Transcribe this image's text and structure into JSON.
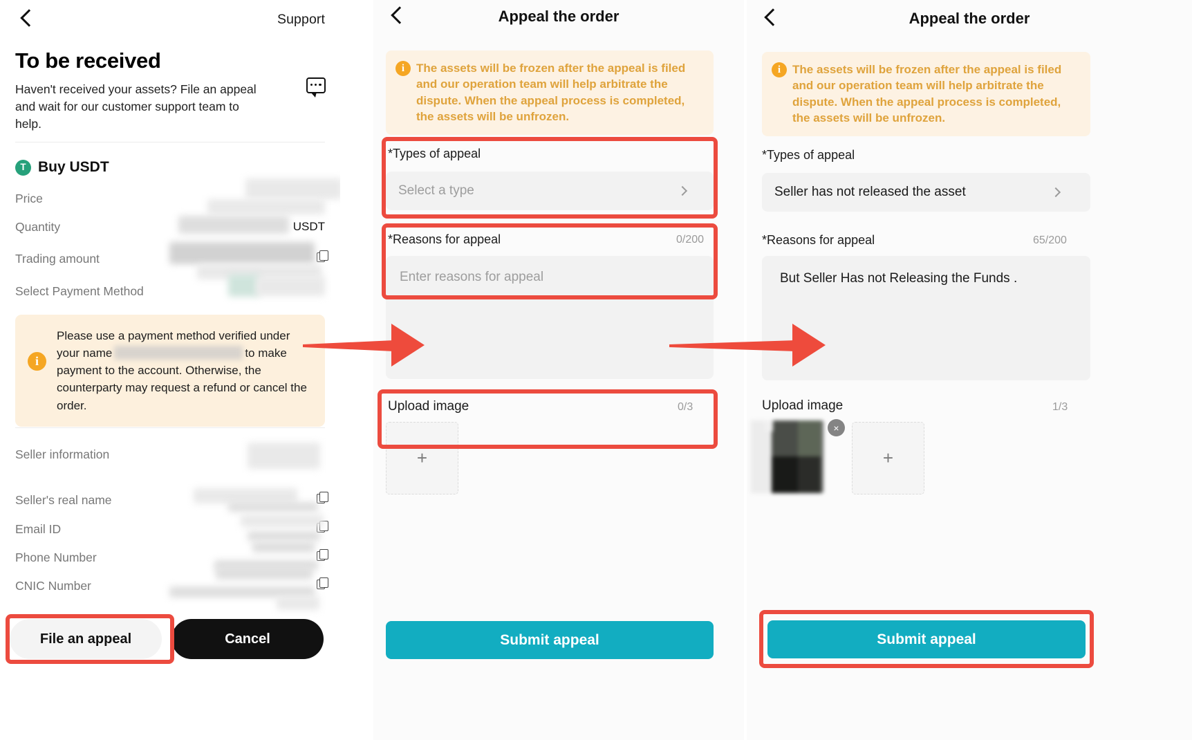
{
  "panel1": {
    "nav": {
      "back_icon": "back-chevron-icon",
      "support_label": "Support"
    },
    "title": "To be received",
    "subtitle": "Haven't received your assets? File an appeal and wait for our customer support team to help.",
    "chat_icon": "chat-bubble-icon",
    "coin": {
      "badge_symbol": "T",
      "label": "Buy USDT",
      "badge_color": "#26A17B"
    },
    "rows": [
      {
        "label": "Price",
        "value": "",
        "suffix": "",
        "copy": false
      },
      {
        "label": "Quantity",
        "value": "",
        "suffix": "USDT",
        "copy": false
      },
      {
        "label": "Trading amount",
        "value": "",
        "suffix": "",
        "copy": true
      },
      {
        "label": "Select Payment Method",
        "value": "",
        "suffix": "",
        "copy": false
      }
    ],
    "warning": {
      "icon": "info-icon",
      "text_before": "Please use a payment method verified under your name",
      "text_after": "to make payment to the account. Otherwise, the counterparty may request a refund or cancel the order.",
      "bg": "#FDF0DD"
    },
    "seller_section": [
      {
        "label": "Seller information",
        "copy": false
      },
      {
        "label": "Seller's real name",
        "copy": true
      },
      {
        "label": "Email ID",
        "copy": true
      },
      {
        "label": "Phone Number",
        "copy": true
      },
      {
        "label": "CNIC Number",
        "copy": true
      }
    ],
    "buttons": {
      "file_appeal": "File an appeal",
      "cancel": "Cancel"
    }
  },
  "panel2": {
    "nav": {
      "back_icon": "back-chevron-icon",
      "title": "Appeal the order"
    },
    "notice": {
      "icon": "info-icon",
      "text": "The assets will be frozen after the appeal is filed and our operation team will help arbitrate the dispute. When the appeal process is completed, the assets will be unfrozen.",
      "color": "#DFA33C",
      "bg": "#FDF2E3"
    },
    "types_of_appeal": {
      "label": "*Types of appeal",
      "value": "",
      "placeholder": "Select a type",
      "chevron_icon": "chevron-right-icon"
    },
    "reasons_for_appeal": {
      "label": "*Reasons for appeal",
      "counter": "0/200",
      "value": "",
      "placeholder": "Enter reasons for appeal"
    },
    "upload": {
      "label": "Upload image",
      "counter": "0/3",
      "add_glyph": "+"
    },
    "submit_label": "Submit appeal",
    "submit_color": "#12ADC1"
  },
  "panel3": {
    "nav": {
      "back_icon": "back-chevron-icon",
      "title": "Appeal the order"
    },
    "notice": {
      "icon": "info-icon",
      "text": "The assets will be frozen after the appeal is filed and our operation team will help arbitrate the dispute. When the appeal process is completed, the assets will be unfrozen.",
      "color": "#DFA33C",
      "bg": "#FDF2E3"
    },
    "types_of_appeal": {
      "label": "*Types of appeal",
      "value": "Seller has not released the asset",
      "placeholder": "Select a type",
      "chevron_icon": "chevron-right-icon"
    },
    "reasons_for_appeal": {
      "label": "*Reasons for appeal",
      "counter": "65/200",
      "value": "But Seller Has not Releasing the Funds .",
      "placeholder": "Enter reasons for appeal"
    },
    "upload": {
      "label": "Upload image",
      "counter": "1/3",
      "add_glyph": "+",
      "remove_glyph": "×",
      "thumbnail_name": "uploaded-screenshot-thumbnail"
    },
    "submit_label": "Submit appeal",
    "submit_color": "#12ADC1"
  },
  "annotations": {
    "highlight_color": "#EC4B3F",
    "arrow_color": "#EE4B3C",
    "arrow_count": 2,
    "highlights": [
      "file-an-appeal-button",
      "types-of-appeal-field",
      "reasons-for-appeal-field",
      "upload-image-field",
      "submit-appeal-button"
    ]
  }
}
